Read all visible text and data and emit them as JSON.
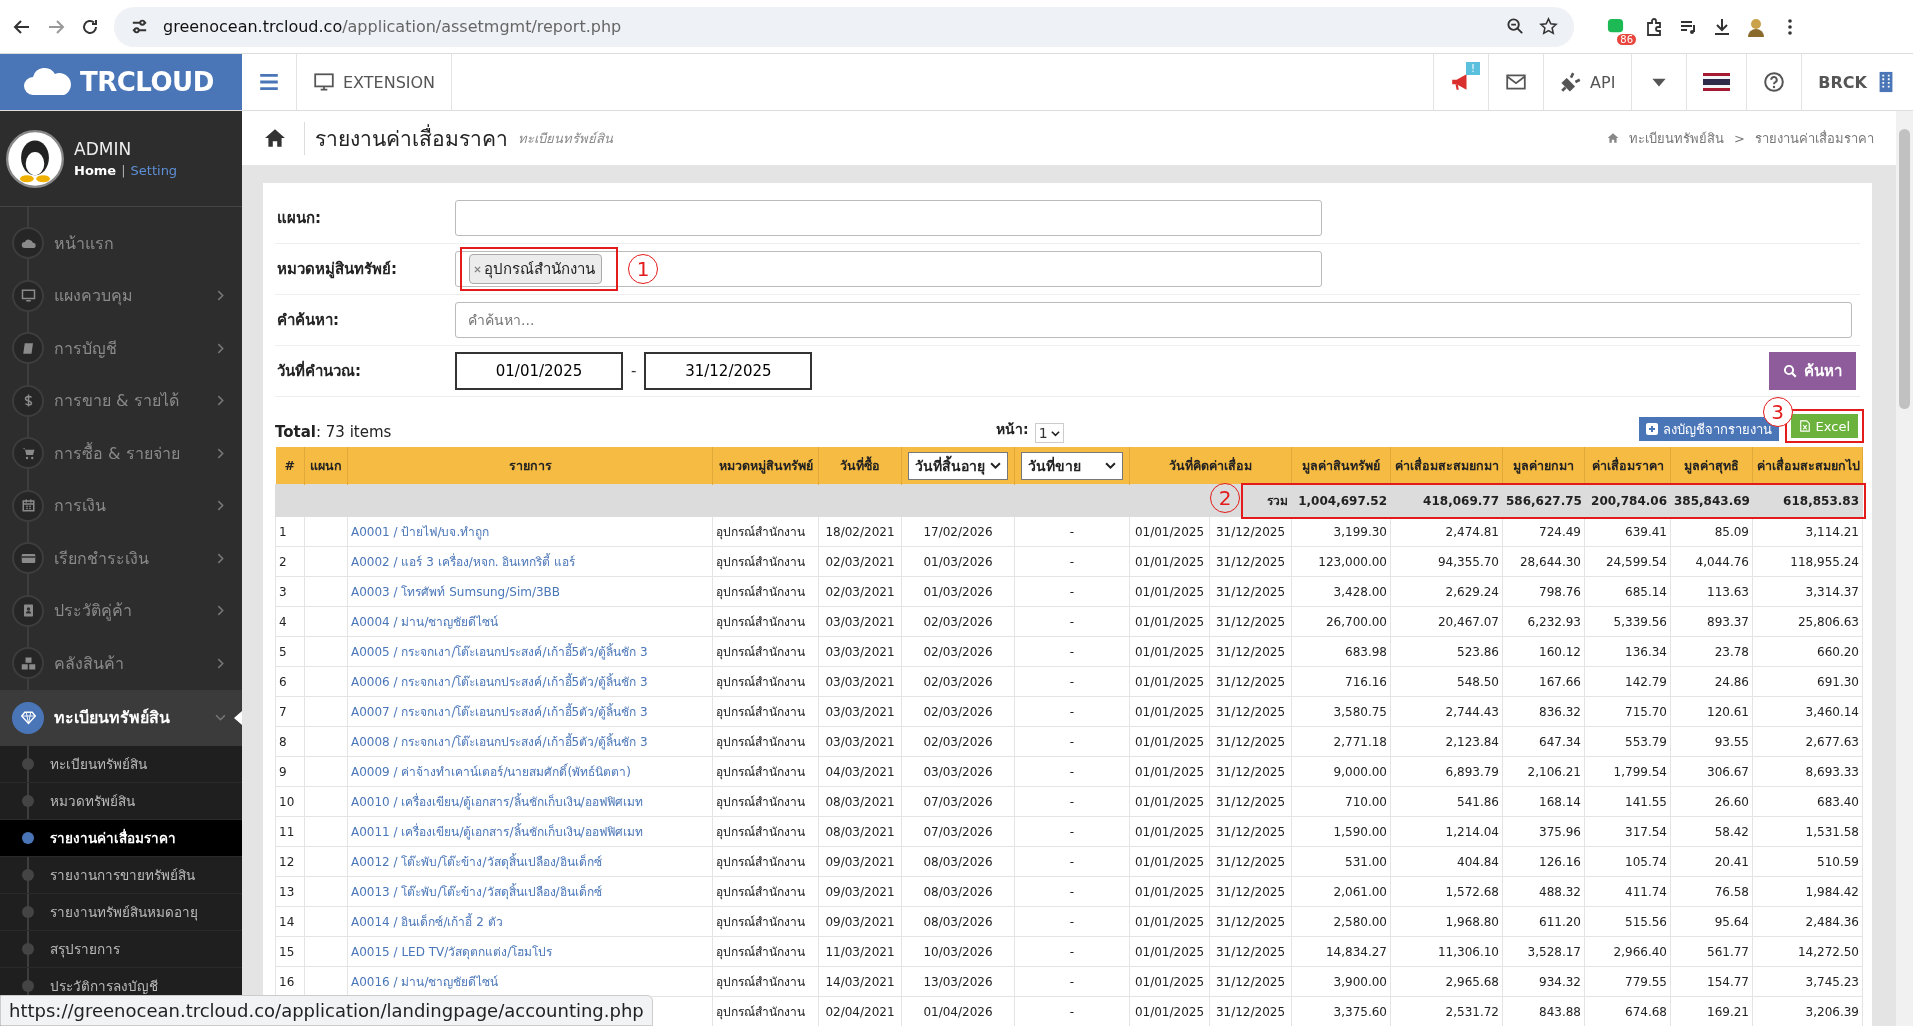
{
  "browser": {
    "domain": "greenocean.trcloud.co",
    "path": "/application/assetmgmt/report.php",
    "extension_badge": "86"
  },
  "header": {
    "logo": "TRCLOUD",
    "extension": "EXTENSION",
    "notification_badge": "!",
    "api": "API",
    "company": "BRCK"
  },
  "sidebar": {
    "user": {
      "name": "ADMIN",
      "home": "Home",
      "separator": "|",
      "setting": "Setting"
    },
    "items": [
      {
        "label": "หน้าแรก",
        "kind": "cloud",
        "expandable": false,
        "selected": false
      },
      {
        "label": "แผงควบคุม",
        "kind": "monitor",
        "expandable": true,
        "selected": false
      },
      {
        "label": "การบัญชี",
        "kind": "book",
        "expandable": true,
        "selected": false
      },
      {
        "label": "การขาย & รายได้",
        "kind": "dollar",
        "expandable": true,
        "selected": false
      },
      {
        "label": "การซื้อ & รายจ่าย",
        "kind": "cart",
        "expandable": true,
        "selected": false
      },
      {
        "label": "การเงิน",
        "kind": "calendar",
        "expandable": true,
        "selected": false
      },
      {
        "label": "เรียกชำระเงิน",
        "kind": "card",
        "expandable": true,
        "selected": false
      },
      {
        "label": "ประวัติคู่ค้า",
        "kind": "contact",
        "expandable": true,
        "selected": false
      },
      {
        "label": "คลังสินค้า",
        "kind": "boxes",
        "expandable": true,
        "selected": false
      },
      {
        "label": "ทะเบียนทรัพย์สิน",
        "kind": "diamond",
        "expandable": true,
        "selected": true,
        "expanded": true,
        "children": [
          {
            "label": "ทะเบียนทรัพย์สิน",
            "selected": false
          },
          {
            "label": "หมวดทรัพย์สิน",
            "selected": false
          },
          {
            "label": "รายงานค่าเสื่อมราคา",
            "selected": true
          },
          {
            "label": "รายงานการขายทรัพย์สิน",
            "selected": false
          },
          {
            "label": "รายงานทรัพย์สินหมดอายุ",
            "selected": false
          },
          {
            "label": "สรุปรายการ",
            "selected": false
          },
          {
            "label": "ประวัติการลงบัญชี",
            "selected": false
          }
        ]
      }
    ]
  },
  "page": {
    "title": "รายงานค่าเสื่อมราคา",
    "subtitle": "ทะเบียนทรัพย์สิน",
    "breadcrumb": [
      "ทะเบียนทรัพย์สิน",
      "รายงานค่าเสื่อมราคา"
    ],
    "breadcrumb_separator": ">"
  },
  "filters": {
    "department": {
      "label": "แผนก:"
    },
    "category": {
      "label": "หมวดหมู่สินทรัพย์:",
      "tags": [
        "อุปกรณ์สำนักงาน"
      ]
    },
    "keyword": {
      "label": "คำค้นหา:",
      "placeholder": "คำค้นหา..."
    },
    "period": {
      "label": "วันที่คำนวณ:",
      "from": "01/01/2025",
      "separator": "-",
      "to": "31/12/2025"
    },
    "search_button": "ค้นหา"
  },
  "toolbar": {
    "total": "**Total**: 73 items",
    "page_label": "หน้า:",
    "page": "1",
    "post_button": "ลงบัญชีจากรายงาน",
    "excel_button": "Excel"
  },
  "annotations": [
    {
      "number": "1"
    },
    {
      "number": "2"
    },
    {
      "number": "3"
    }
  ],
  "table": {
    "columns": [
      {
        "label": "#",
        "kind": "text"
      },
      {
        "label": "แผนก",
        "kind": "text"
      },
      {
        "label": "รายการ",
        "kind": "text"
      },
      {
        "label": "หมวดหมู่สินทรัพย์",
        "kind": "text"
      },
      {
        "label": "วันที่ซื้อ",
        "kind": "text"
      },
      {
        "label": "วันที่สิ้นอายุ",
        "kind": "select"
      },
      {
        "label": "วันที่ขาย",
        "kind": "select"
      },
      {
        "label": "วันที่คิดค่าเสื่อม",
        "kind": "wide"
      },
      {
        "label": "มูลค่าสินทรัพย์",
        "kind": "text"
      },
      {
        "label": "ค่าเสื่อมสะสมยกมา",
        "kind": "text"
      },
      {
        "label": "มูลค่ายกมา",
        "kind": "text"
      },
      {
        "label": "ค่าเสื่อมราคา",
        "kind": "text"
      },
      {
        "label": "มูลค่าสุทธิ",
        "kind": "text"
      },
      {
        "label": "ค่าเสื่อมสะสมยกไป",
        "kind": "text"
      }
    ],
    "total": {
      "label": "รวม",
      "amounts": [
        "1,004,697.52",
        "418,069.77",
        "586,627.75",
        "200,784.06",
        "385,843.69",
        "618,853.83"
      ]
    },
    "rows": [
      {
        "num": "1",
        "item": "A0001 / ป้ายไฟ/บจ.ทำถูก",
        "category": "อุปกรณ์สำนักงาน",
        "purchased": "18/02/2021",
        "expires": "17/02/2026",
        "sold": "-",
        "calc_from": "01/01/2025",
        "calc_to": "31/12/2025",
        "amounts": [
          "3,199.30",
          "2,474.81",
          "724.49",
          "639.41",
          "85.09",
          "3,114.21"
        ]
      },
      {
        "num": "2",
        "item": "A0002 / แอร์ 3 เครื่อง/หจก. อินเทกริตี้ แอร์",
        "category": "อุปกรณ์สำนักงาน",
        "purchased": "02/03/2021",
        "expires": "01/03/2026",
        "sold": "-",
        "calc_from": "01/01/2025",
        "calc_to": "31/12/2025",
        "amounts": [
          "123,000.00",
          "94,355.70",
          "28,644.30",
          "24,599.54",
          "4,044.76",
          "118,955.24"
        ]
      },
      {
        "num": "3",
        "item": "A0003 / โทรศัพท์ Sumsung/Sim/3BB",
        "category": "อุปกรณ์สำนักงาน",
        "purchased": "02/03/2021",
        "expires": "01/03/2026",
        "sold": "-",
        "calc_from": "01/01/2025",
        "calc_to": "31/12/2025",
        "amounts": [
          "3,428.00",
          "2,629.24",
          "798.76",
          "685.14",
          "113.63",
          "3,314.37"
        ]
      },
      {
        "num": "4",
        "item": "A0004 / ม่าน/ชาญชัยดีไซน์",
        "category": "อุปกรณ์สำนักงาน",
        "purchased": "03/03/2021",
        "expires": "02/03/2026",
        "sold": "-",
        "calc_from": "01/01/2025",
        "calc_to": "31/12/2025",
        "amounts": [
          "26,700.00",
          "20,467.07",
          "6,232.93",
          "5,339.56",
          "893.37",
          "25,806.63"
        ]
      },
      {
        "num": "5",
        "item": "A0005 / กระจกเงา/โต๊ะเอนกประสงค์/เก้าอี้5ตัว/ตู้ลิ้นชัก 3",
        "category": "อุปกรณ์สำนักงาน",
        "purchased": "03/03/2021",
        "expires": "02/03/2026",
        "sold": "-",
        "calc_from": "01/01/2025",
        "calc_to": "31/12/2025",
        "amounts": [
          "683.98",
          "523.86",
          "160.12",
          "136.34",
          "23.78",
          "660.20"
        ]
      },
      {
        "num": "6",
        "item": "A0006 / กระจกเงา/โต๊ะเอนกประสงค์/เก้าอี้5ตัว/ตู้ลิ้นชัก 3",
        "category": "อุปกรณ์สำนักงาน",
        "purchased": "03/03/2021",
        "expires": "02/03/2026",
        "sold": "-",
        "calc_from": "01/01/2025",
        "calc_to": "31/12/2025",
        "amounts": [
          "716.16",
          "548.50",
          "167.66",
          "142.79",
          "24.86",
          "691.30"
        ]
      },
      {
        "num": "7",
        "item": "A0007 / กระจกเงา/โต๊ะเอนกประสงค์/เก้าอี้5ตัว/ตู้ลิ้นชัก 3",
        "category": "อุปกรณ์สำนักงาน",
        "purchased": "03/03/2021",
        "expires": "02/03/2026",
        "sold": "-",
        "calc_from": "01/01/2025",
        "calc_to": "31/12/2025",
        "amounts": [
          "3,580.75",
          "2,744.43",
          "836.32",
          "715.70",
          "120.61",
          "3,460.14"
        ]
      },
      {
        "num": "8",
        "item": "A0008 / กระจกเงา/โต๊ะเอนกประสงค์/เก้าอี้5ตัว/ตู้ลิ้นชัก 3",
        "category": "อุปกรณ์สำนักงาน",
        "purchased": "03/03/2021",
        "expires": "02/03/2026",
        "sold": "-",
        "calc_from": "01/01/2025",
        "calc_to": "31/12/2025",
        "amounts": [
          "2,771.18",
          "2,123.84",
          "647.34",
          "553.79",
          "93.55",
          "2,677.63"
        ]
      },
      {
        "num": "9",
        "item": "A0009 / ค่าจ้างทำเคาน์เตอร์/นายสมศักดิ์(พัทธ์นิตตา)",
        "category": "อุปกรณ์สำนักงาน",
        "purchased": "04/03/2021",
        "expires": "03/03/2026",
        "sold": "-",
        "calc_from": "01/01/2025",
        "calc_to": "31/12/2025",
        "amounts": [
          "9,000.00",
          "6,893.79",
          "2,106.21",
          "1,799.54",
          "306.67",
          "8,693.33"
        ]
      },
      {
        "num": "10",
        "item": "A0010 / เครื่องเขียน/ตู้เอกสาร/ลิ้นชักเก็บเงิน/ออฟฟิศเมท",
        "category": "อุปกรณ์สำนักงาน",
        "purchased": "08/03/2021",
        "expires": "07/03/2026",
        "sold": "-",
        "calc_from": "01/01/2025",
        "calc_to": "31/12/2025",
        "amounts": [
          "710.00",
          "541.86",
          "168.14",
          "141.55",
          "26.60",
          "683.40"
        ]
      },
      {
        "num": "11",
        "item": "A0011 / เครื่องเขียน/ตู้เอกสาร/ลิ้นชักเก็บเงิน/ออฟฟิศเมท",
        "category": "อุปกรณ์สำนักงาน",
        "purchased": "08/03/2021",
        "expires": "07/03/2026",
        "sold": "-",
        "calc_from": "01/01/2025",
        "calc_to": "31/12/2025",
        "amounts": [
          "1,590.00",
          "1,214.04",
          "375.96",
          "317.54",
          "58.42",
          "1,531.58"
        ]
      },
      {
        "num": "12",
        "item": "A0012 / โต๊ะพับ/โต๊ะข้าง/วัสดุสิ้นเปลือง/อินเด็กซ์",
        "category": "อุปกรณ์สำนักงาน",
        "purchased": "09/03/2021",
        "expires": "08/03/2026",
        "sold": "-",
        "calc_from": "01/01/2025",
        "calc_to": "31/12/2025",
        "amounts": [
          "531.00",
          "404.84",
          "126.16",
          "105.74",
          "20.41",
          "510.59"
        ]
      },
      {
        "num": "13",
        "item": "A0013 / โต๊ะพับ/โต๊ะข้าง/วัสดุสิ้นเปลือง/อินเด็กซ์",
        "category": "อุปกรณ์สำนักงาน",
        "purchased": "09/03/2021",
        "expires": "08/03/2026",
        "sold": "-",
        "calc_from": "01/01/2025",
        "calc_to": "31/12/2025",
        "amounts": [
          "2,061.00",
          "1,572.68",
          "488.32",
          "411.74",
          "76.58",
          "1,984.42"
        ]
      },
      {
        "num": "14",
        "item": "A0014 / อินเด็กซ์/เก้าอี้ 2 ตัว",
        "category": "อุปกรณ์สำนักงาน",
        "purchased": "09/03/2021",
        "expires": "08/03/2026",
        "sold": "-",
        "calc_from": "01/01/2025",
        "calc_to": "31/12/2025",
        "amounts": [
          "2,580.00",
          "1,968.80",
          "611.20",
          "515.56",
          "95.64",
          "2,484.36"
        ]
      },
      {
        "num": "15",
        "item": "A0015 / LED TV/วัสดุตกแต่ง/โฮมโปร",
        "category": "อุปกรณ์สำนักงาน",
        "purchased": "11/03/2021",
        "expires": "10/03/2026",
        "sold": "-",
        "calc_from": "01/01/2025",
        "calc_to": "31/12/2025",
        "amounts": [
          "14,834.27",
          "11,306.10",
          "3,528.17",
          "2,966.40",
          "561.77",
          "14,272.50"
        ]
      },
      {
        "num": "16",
        "item": "A0016 / ม่าน/ชาญชัยดีไซน์",
        "category": "อุปกรณ์สำนักงาน",
        "purchased": "14/03/2021",
        "expires": "13/03/2026",
        "sold": "-",
        "calc_from": "01/01/2025",
        "calc_to": "31/12/2025",
        "amounts": [
          "3,900.00",
          "2,965.68",
          "934.32",
          "779.55",
          "154.77",
          "3,745.23"
        ]
      },
      {
        "category": "อุปกรณ์สำนักงาน",
        "purchased": "02/04/2021",
        "expires": "01/04/2026",
        "sold": "-",
        "calc_from": "01/01/2025",
        "calc_to": "31/12/2025",
        "amounts": [
          "3,375.60",
          "2,531.72",
          "843.88",
          "674.68",
          "169.21",
          "3,206.39"
        ]
      }
    ]
  },
  "status_url": "https://greenocean.trcloud.co/application/landingpage/accounting.php"
}
